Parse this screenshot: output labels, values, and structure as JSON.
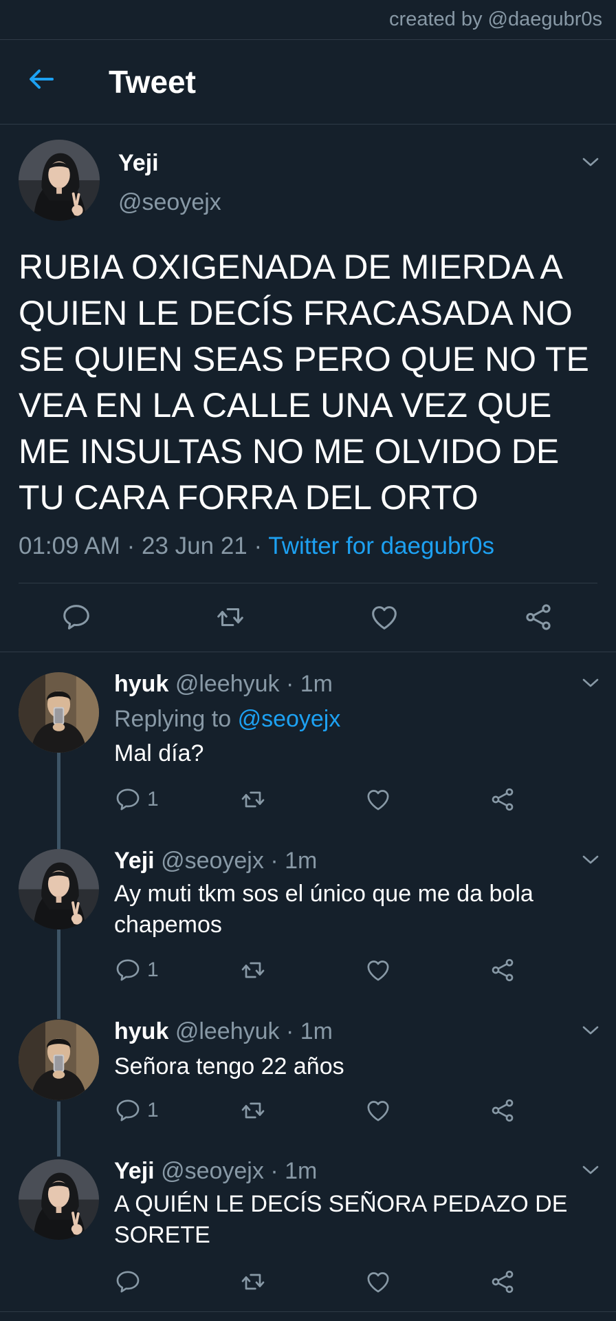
{
  "credit": "created by @daegubr0s",
  "header": {
    "title": "Tweet"
  },
  "main_tweet": {
    "name": "Yeji",
    "handle": "@seoyejx",
    "text": "RUBIA OXIGENADA DE MIERDA A QUIEN LE DECÍS FRACASADA NO SE QUIEN SEAS PERO QUE NO TE VEA EN LA CALLE UNA VEZ QUE ME INSULTAS NO ME OLVIDO DE TU CARA FORRA DEL ORTO",
    "time": "01:09 AM",
    "date": "23 Jun 21",
    "separator": "·",
    "source": "Twitter for daegubr0s"
  },
  "replies": [
    {
      "name": "hyuk",
      "handle": "@leehyuk",
      "time": "1m",
      "replying_label": "Replying to",
      "replying_to": "@seoyejx",
      "text": "Mal día?",
      "reply_count": "1"
    },
    {
      "name": "Yeji",
      "handle": "@seoyejx",
      "time": "1m",
      "text": "Ay muti tkm sos el único que me da bola chapemos",
      "reply_count": "1"
    },
    {
      "name": "hyuk",
      "handle": "@leehyuk",
      "time": "1m",
      "text": "Señora tengo 22 años",
      "reply_count": "1"
    },
    {
      "name": "Yeji",
      "handle": "@seoyejx",
      "time": "1m",
      "text": "A QUIÉN LE DECÍS SEÑORA PEDAZO DE SORETE",
      "reply_count": ""
    }
  ],
  "colors": {
    "background": "#15202b",
    "accent": "#1da1f2",
    "muted": "#8899a6",
    "divider": "#2f3b47"
  },
  "icons": [
    "back-arrow-icon",
    "chevron-down-icon",
    "reply-icon",
    "retweet-icon",
    "like-icon",
    "share-icon"
  ]
}
